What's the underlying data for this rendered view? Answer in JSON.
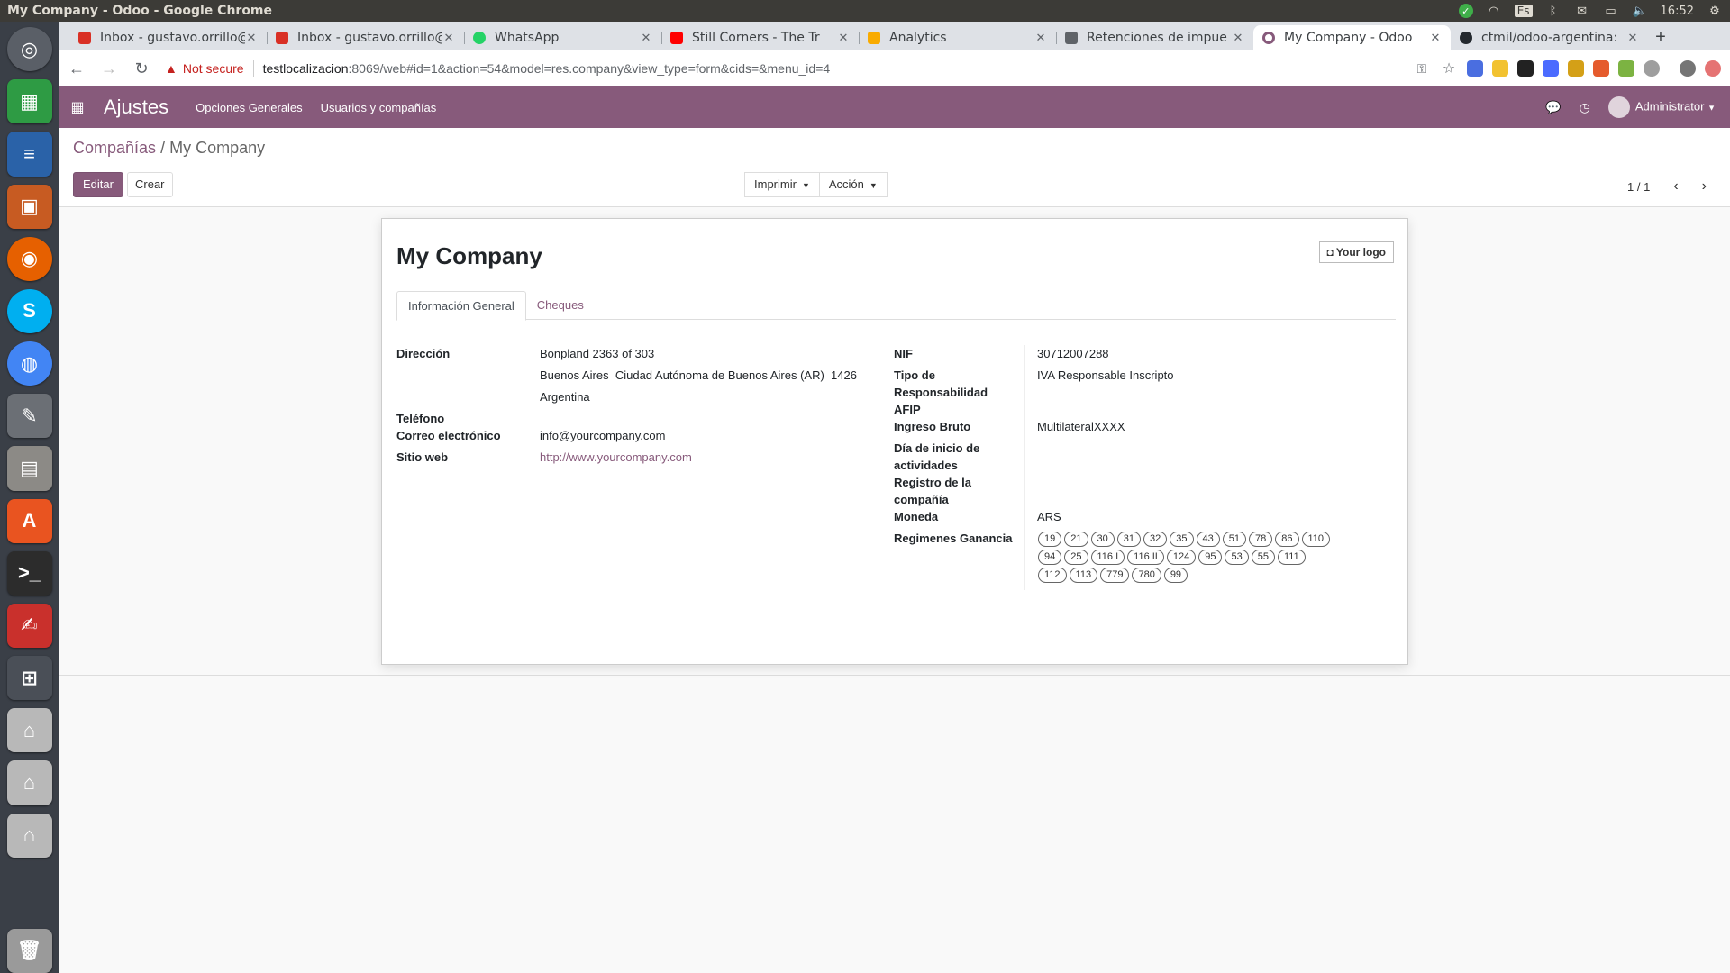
{
  "window": {
    "title": "My Company - Odoo - Google Chrome",
    "clock": "16:52",
    "keyboard": "Es"
  },
  "tabs": [
    {
      "title": "Inbox - gustavo.orrillo@",
      "color": "#d93025"
    },
    {
      "title": "Inbox - gustavo.orrillo@",
      "color": "#d93025"
    },
    {
      "title": "WhatsApp",
      "color": "#25d366"
    },
    {
      "title": "Still Corners - The Tr",
      "color": "#ff0000"
    },
    {
      "title": "Analytics",
      "color": "#f9ab00"
    },
    {
      "title": "Retenciones de impue",
      "color": "#5f6368"
    },
    {
      "title": "My Company - Odoo",
      "color": "#875a7b"
    },
    {
      "title": "ctmil/odoo-argentina:",
      "color": "#24292e"
    }
  ],
  "address": {
    "not_secure": "Not secure",
    "host": "testlocalizacion",
    "rest": ":8069/web#id=1&action=54&model=res.company&view_type=form&cids=&menu_id=4"
  },
  "navbar": {
    "app": "Ajustes",
    "menu1": "Opciones Generales",
    "menu2": "Usuarios y compañías",
    "user": "Administrator"
  },
  "breadcrumb": {
    "parent": "Compañías",
    "sep": "/",
    "current": "My Company"
  },
  "toolbar": {
    "edit": "Editar",
    "create": "Crear",
    "print": "Imprimir",
    "action": "Acción",
    "pager": "1 / 1"
  },
  "form": {
    "name": "My Company",
    "logo_btn": "Your logo",
    "tab1": "Información General",
    "tab2": "Cheques",
    "left": {
      "addr_label": "Dirección",
      "street": "Bonpland 2363 of 303",
      "city_line": "Buenos Aires  Ciudad Autónoma de Buenos Aires (AR)  1426",
      "country": "Argentina",
      "phone_label": "Teléfono",
      "email_label": "Correo electrónico",
      "email": "info@yourcompany.com",
      "web_label": "Sitio web",
      "web": "http://www.yourcompany.com"
    },
    "right": {
      "nif_label": "NIF",
      "nif": "30712007288",
      "resp_label_1": "Tipo de",
      "resp_label_2": "Responsabilidad",
      "resp_label_3": "AFIP",
      "resp": "IVA Responsable Inscripto",
      "iibb_label": "Ingreso Bruto",
      "iibb": "MultilateralXXXX",
      "start_label_1": "Día de inicio de",
      "start_label_2": "actividades",
      "reg_label_1": "Registro de la",
      "reg_label_2": "compañía",
      "currency_label": "Moneda",
      "currency": "ARS",
      "regimes_label": "Regimenes Ganancia"
    },
    "regimes": [
      "19",
      "21",
      "30",
      "31",
      "32",
      "35",
      "43",
      "51",
      "78",
      "86",
      "110",
      "94",
      "25",
      "116 I",
      "116 II",
      "124",
      "95",
      "53",
      "55",
      "111",
      "112",
      "113",
      "779",
      "780",
      "99"
    ]
  }
}
